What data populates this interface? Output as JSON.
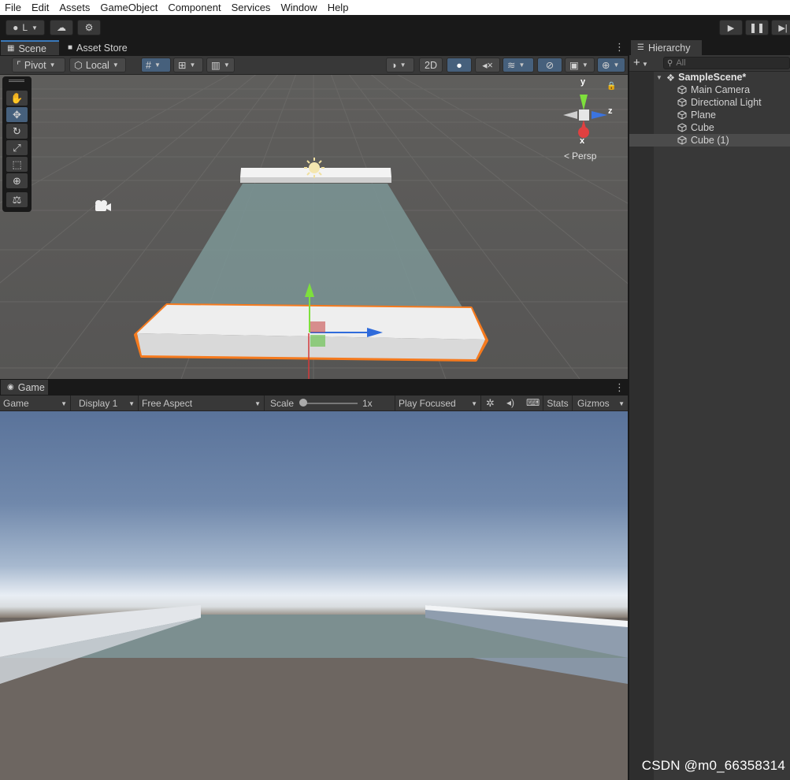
{
  "menu": [
    "File",
    "Edit",
    "Assets",
    "GameObject",
    "Component",
    "Services",
    "Window",
    "Help"
  ],
  "toolbar": {
    "account_label": "L"
  },
  "scene_tabs": [
    "Scene",
    "Asset Store"
  ],
  "scene_toolbar": {
    "pivot": "Pivot",
    "local": "Local",
    "mode_2d": "2D"
  },
  "gizmo": {
    "y": "y",
    "z": "z",
    "x": "x",
    "persp": "Persp"
  },
  "game_tab": "Game",
  "game_toolbar": {
    "view": "Game",
    "display": "Display 1",
    "aspect": "Free Aspect",
    "scale_label": "Scale",
    "scale_value": "1x",
    "play_mode": "Play Focused",
    "stats": "Stats",
    "gizmos": "Gizmos"
  },
  "hierarchy": {
    "tab": "Hierarchy",
    "search_placeholder": "All",
    "scene": "SampleScene*",
    "items": [
      "Main Camera",
      "Directional Light",
      "Plane",
      "Cube",
      "Cube (1)"
    ],
    "selected_index": 4
  },
  "watermark": "CSDN @m0_66358314",
  "colors": {
    "accent": "#3a79bb",
    "selection_outline": "#f57a1e",
    "panel": "#383838",
    "toolbar_bg": "#191919"
  }
}
